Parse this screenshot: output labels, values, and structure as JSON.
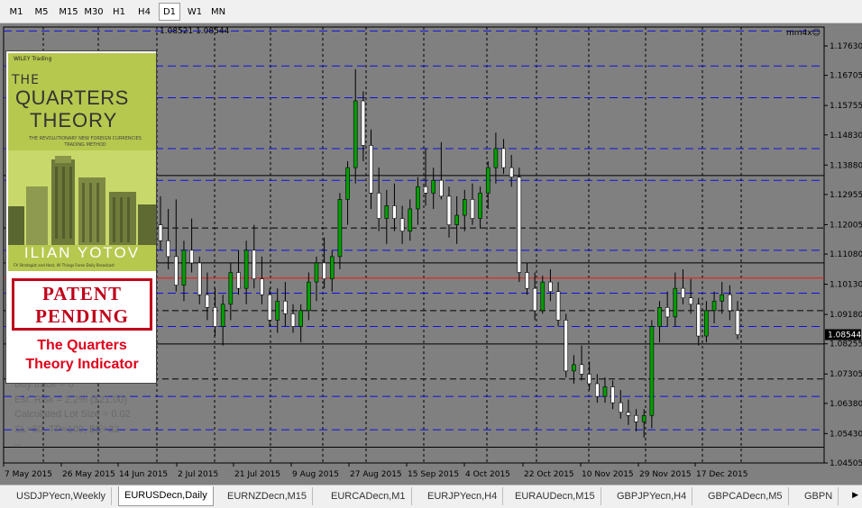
{
  "toolbar": {
    "timeframes": [
      "M1",
      "M5",
      "M15",
      "M30",
      "H1",
      "H4",
      "D1",
      "W1",
      "MN"
    ],
    "active": "D1"
  },
  "chart": {
    "header_values": "1.08521 1.08544",
    "indicator_label": "mm4x",
    "current_price_label": "1.08544",
    "price_ticks": [
      "1.17630",
      "1.16705",
      "1.15755",
      "1.14830",
      "1.13880",
      "1.12955",
      "1.12005",
      "1.11080",
      "1.10130",
      "1.09180",
      "1.08255",
      "1.07305",
      "1.06380",
      "1.05430",
      "1.04505"
    ],
    "date_ticks": [
      "7 May 2015",
      "26 May 2015",
      "14 Jun 2015",
      "2 Jul 2015",
      "21 Jul 2015",
      "9 Aug 2015",
      "27 Aug 2015",
      "15 Sep 2015",
      "4 Oct 2015",
      "22 Oct 2015",
      "10 Nov 2015",
      "29 Nov 2015",
      "17 Dec 2015"
    ],
    "overlay_lines": [
      "Sell trade = 0",
      "Buy trade = 0",
      "Est. Risk = 2.2% ($21.00)",
      "Calculated Lot Size = 0.02",
      "SL=50, TP=100, BE=32",
      "--"
    ]
  },
  "book": {
    "publisher": "WILEY Trading",
    "title_line1": "THE",
    "title_line2": "QUARTERS",
    "title_line3": "THEORY",
    "subtitle": "THE REVOLUTIONARY NEW FOREIGN CURRENCIES TRADING METHOD",
    "author": "ILIAN YOTOV",
    "author_note": "FX Strategist and Host, All Things Forex Daily Broadcast",
    "stamp_line1": "PATENT",
    "stamp_line2": "PENDING",
    "caption_line1": "The Quarters",
    "caption_line2": "Theory Indicator"
  },
  "tabs": {
    "items": [
      "USDJPYecn,Weekly",
      "EURUSDecn,Daily",
      "EURNZDecn,M15",
      "EURCADecn,M1",
      "EURJPYecn,H4",
      "EURAUDecn,M15",
      "GBPJPYecn,H4",
      "GBPCADecn,M5",
      "GBPN"
    ],
    "active": "EURUSDecn,Daily"
  },
  "chart_data": {
    "type": "candlestick",
    "symbol": "EURUSDecn",
    "timeframe": "Daily",
    "ylim": [
      1.04505,
      1.1763
    ],
    "ohlc": [
      [
        1.12,
        1.129,
        1.112,
        1.115
      ],
      [
        1.115,
        1.125,
        1.106,
        1.11
      ],
      [
        1.11,
        1.128,
        1.099,
        1.101
      ],
      [
        1.101,
        1.115,
        1.096,
        1.112
      ],
      [
        1.112,
        1.122,
        1.105,
        1.108
      ],
      [
        1.108,
        1.11,
        1.095,
        1.098
      ],
      [
        1.098,
        1.105,
        1.09,
        1.094
      ],
      [
        1.094,
        1.1,
        1.085,
        1.088
      ],
      [
        1.088,
        1.098,
        1.082,
        1.095
      ],
      [
        1.095,
        1.108,
        1.09,
        1.105
      ],
      [
        1.105,
        1.112,
        1.098,
        1.1
      ],
      [
        1.1,
        1.115,
        1.095,
        1.112
      ],
      [
        1.112,
        1.12,
        1.1,
        1.103
      ],
      [
        1.103,
        1.11,
        1.095,
        1.098
      ],
      [
        1.098,
        1.1,
        1.088,
        1.09
      ],
      [
        1.09,
        1.1,
        1.086,
        1.096
      ],
      [
        1.096,
        1.102,
        1.088,
        1.092
      ],
      [
        1.092,
        1.095,
        1.086,
        1.088
      ],
      [
        1.088,
        1.095,
        1.083,
        1.093
      ],
      [
        1.093,
        1.105,
        1.09,
        1.102
      ],
      [
        1.102,
        1.11,
        1.096,
        1.108
      ],
      [
        1.108,
        1.116,
        1.1,
        1.103
      ],
      [
        1.103,
        1.112,
        1.099,
        1.11
      ],
      [
        1.11,
        1.13,
        1.106,
        1.128
      ],
      [
        1.128,
        1.14,
        1.12,
        1.138
      ],
      [
        1.138,
        1.169,
        1.133,
        1.159
      ],
      [
        1.159,
        1.162,
        1.14,
        1.145
      ],
      [
        1.145,
        1.15,
        1.125,
        1.13
      ],
      [
        1.13,
        1.138,
        1.118,
        1.122
      ],
      [
        1.122,
        1.131,
        1.114,
        1.126
      ],
      [
        1.126,
        1.133,
        1.118,
        1.122
      ],
      [
        1.122,
        1.126,
        1.114,
        1.118
      ],
      [
        1.118,
        1.128,
        1.115,
        1.125
      ],
      [
        1.125,
        1.135,
        1.12,
        1.132
      ],
      [
        1.132,
        1.144,
        1.126,
        1.13
      ],
      [
        1.13,
        1.138,
        1.125,
        1.134
      ],
      [
        1.134,
        1.146,
        1.128,
        1.129
      ],
      [
        1.129,
        1.132,
        1.116,
        1.12
      ],
      [
        1.12,
        1.129,
        1.114,
        1.123
      ],
      [
        1.123,
        1.131,
        1.118,
        1.128
      ],
      [
        1.128,
        1.133,
        1.12,
        1.122
      ],
      [
        1.122,
        1.132,
        1.119,
        1.13
      ],
      [
        1.13,
        1.14,
        1.125,
        1.138
      ],
      [
        1.138,
        1.149,
        1.133,
        1.144
      ],
      [
        1.144,
        1.147,
        1.136,
        1.138
      ],
      [
        1.138,
        1.142,
        1.132,
        1.135
      ],
      [
        1.135,
        1.138,
        1.102,
        1.105
      ],
      [
        1.105,
        1.108,
        1.098,
        1.1
      ],
      [
        1.1,
        1.105,
        1.09,
        1.093
      ],
      [
        1.093,
        1.104,
        1.092,
        1.102
      ],
      [
        1.102,
        1.106,
        1.096,
        1.099
      ],
      [
        1.099,
        1.102,
        1.088,
        1.09
      ],
      [
        1.09,
        1.092,
        1.072,
        1.074
      ],
      [
        1.074,
        1.079,
        1.07,
        1.076
      ],
      [
        1.076,
        1.082,
        1.071,
        1.073
      ],
      [
        1.073,
        1.077,
        1.068,
        1.07
      ],
      [
        1.07,
        1.073,
        1.064,
        1.066
      ],
      [
        1.066,
        1.072,
        1.064,
        1.069
      ],
      [
        1.069,
        1.071,
        1.062,
        1.064
      ],
      [
        1.064,
        1.068,
        1.059,
        1.061
      ],
      [
        1.061,
        1.065,
        1.057,
        1.06
      ],
      [
        1.06,
        1.062,
        1.055,
        1.058
      ],
      [
        1.058,
        1.062,
        1.053,
        1.06
      ],
      [
        1.06,
        1.09,
        1.056,
        1.088
      ],
      [
        1.088,
        1.096,
        1.083,
        1.094
      ],
      [
        1.094,
        1.099,
        1.088,
        1.091
      ],
      [
        1.091,
        1.105,
        1.088,
        1.1
      ],
      [
        1.1,
        1.106,
        1.095,
        1.097
      ],
      [
        1.097,
        1.103,
        1.092,
        1.095
      ],
      [
        1.095,
        1.097,
        1.082,
        1.085
      ],
      [
        1.085,
        1.096,
        1.083,
        1.093
      ],
      [
        1.093,
        1.099,
        1.089,
        1.096
      ],
      [
        1.096,
        1.102,
        1.092,
        1.098
      ],
      [
        1.098,
        1.101,
        1.09,
        1.093
      ],
      [
        1.093,
        1.096,
        1.084,
        1.0854
      ]
    ],
    "horizontal_levels": {
      "black_solid": [
        1.1355,
        1.108,
        1.0825,
        1.05
      ],
      "black_dashed": [
        1.119,
        1.093,
        1.0715
      ],
      "blue_dashed": [
        1.181,
        1.17,
        1.16,
        1.144,
        1.134,
        1.112,
        1.0985,
        1.088,
        1.066,
        1.0555
      ],
      "red_solid": [
        1.10325
      ]
    }
  }
}
